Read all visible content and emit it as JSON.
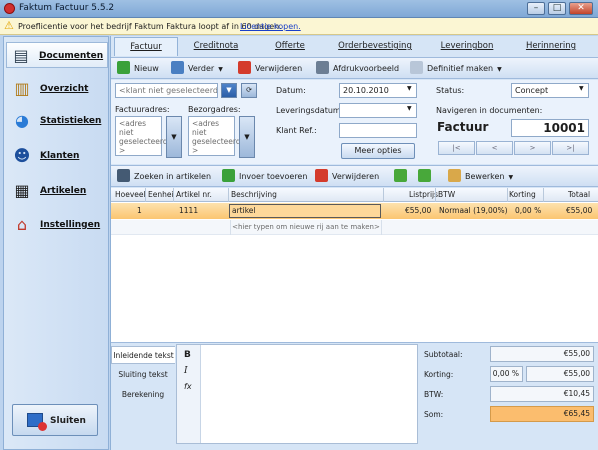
{
  "window": {
    "title": "Faktum Factuur 5.5.2",
    "controls": {
      "minimize": "–",
      "maximize": "□",
      "close": "✕"
    }
  },
  "license": {
    "text": "Proeflicentie voor het bedrijf Faktum Faktura loopt af in 60 dagen.",
    "link": "Licentie kopen."
  },
  "sidebar": {
    "items": [
      {
        "label": "Documenten",
        "icon": "documents-icon"
      },
      {
        "label": "Overzicht",
        "icon": "overview-icon"
      },
      {
        "label": "Statistieken",
        "icon": "statistics-icon"
      },
      {
        "label": "Klanten",
        "icon": "customers-icon"
      },
      {
        "label": "Artikelen",
        "icon": "articles-icon"
      },
      {
        "label": "Instellingen",
        "icon": "settings-icon"
      }
    ],
    "close_label": "Sluiten"
  },
  "tabs": [
    "Factuur",
    "Creditnota",
    "Offerte",
    "Orderbevestiging",
    "Leveringbon",
    "Herinnering"
  ],
  "toolbar1": {
    "new": "Nieuw",
    "next": "Verder",
    "delete": "Verwijderen",
    "print_preview": "Afdrukvoorbeeld",
    "finalize": "Definitief maken"
  },
  "form": {
    "customer_placeholder": "<klant niet geselecteerd",
    "invoice_address_label": "Factuuradres:",
    "delivery_address_label": "Bezorgadres:",
    "address_placeholder_lines": [
      "<adres niet",
      "geselecteerd",
      ">"
    ],
    "date_label": "Datum:",
    "date_value": "20.10.2010",
    "delivery_date_label": "Leveringsdatum:",
    "delivery_date_value": "",
    "customer_ref_label": "Klant Ref.:",
    "customer_ref_value": "",
    "more_options": "Meer opties",
    "status_label": "Status:",
    "status_value": "Concept",
    "navigate_label": "Navigeren in documenten:",
    "doc_type": "Factuur",
    "doc_number": "10001",
    "nav": [
      "|<",
      "<",
      ">",
      ">|"
    ]
  },
  "toolbar2": {
    "search_articles": "Zoeken in artikelen",
    "insert": "Invoer toevoeren",
    "delete": "Verwijderen",
    "edit": "Bewerken"
  },
  "grid": {
    "columns": [
      "Hoeveel",
      "Eenhei",
      "Artikel nr.",
      "Beschrijving",
      "Listprijs",
      "BTW",
      "Korting",
      "Totaal"
    ],
    "rows": [
      {
        "qty": "1",
        "unit": "",
        "article_no": "1111",
        "description": "artikel",
        "list_price": "€55,00",
        "vat": "Normaal (19,00%)",
        "discount": "0,00 %",
        "total": "€55,00"
      }
    ],
    "new_row_hint": "<hier typen om nieuwe rij aan te maken>"
  },
  "bottom_tabs": [
    "Inleidende tekst",
    "Sluiting tekst",
    "Berekening"
  ],
  "editor_tools": {
    "bold": "B",
    "italic": "I",
    "fx": "fx"
  },
  "summary": {
    "subtotal_label": "Subtotaal:",
    "subtotal": "€55,00",
    "discount_label": "Korting:",
    "discount_pct": "0,00 %",
    "discount_value": "€55,00",
    "vat_label": "BTW:",
    "vat": "€10,45",
    "sum_label": "Som:",
    "sum": "€65,45"
  },
  "colors": {
    "selected_row": "#fbc571",
    "sum_highlight": "#fbbd6e",
    "license_bar": "#fbf6d3"
  }
}
